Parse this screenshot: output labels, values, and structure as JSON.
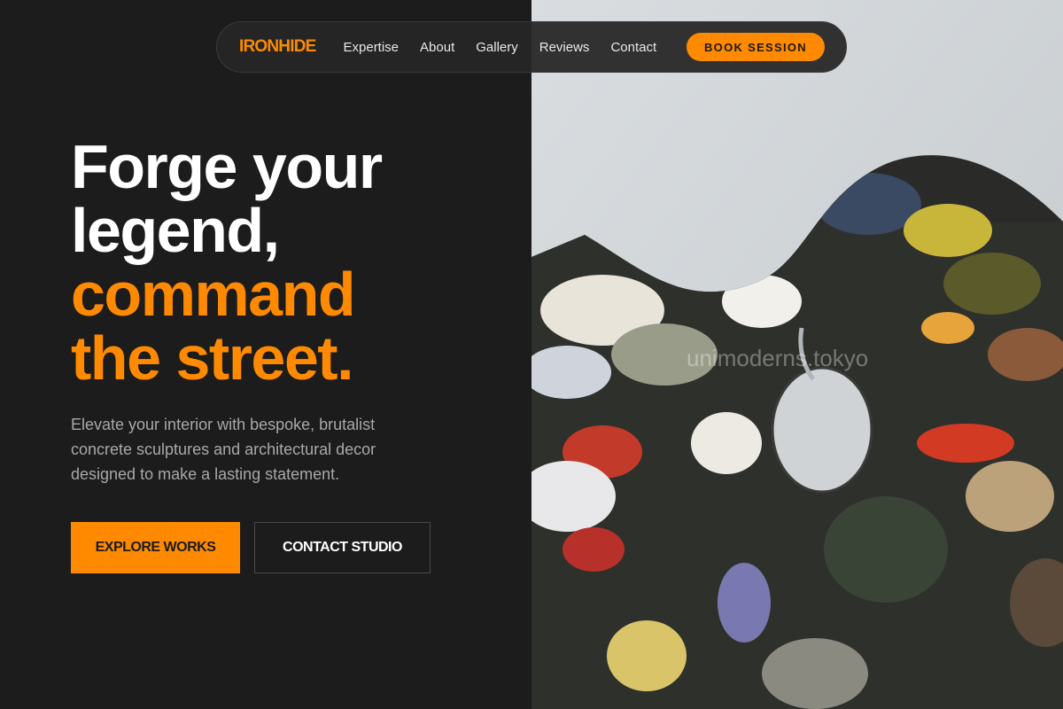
{
  "nav": {
    "logo": "IRONHIDE",
    "links": [
      "Expertise",
      "About",
      "Gallery",
      "Reviews",
      "Contact"
    ],
    "cta": "BOOK SESSION"
  },
  "hero": {
    "line1": "Forge your",
    "line2": "legend,",
    "line3": "command",
    "line4": "the street.",
    "subtitle": "Elevate your interior with bespoke, brutalist concrete sculptures and architectural decor designed to make a lasting statement.",
    "primary_button": "EXPLORE WORKS",
    "secondary_button": "CONTACT STUDIO"
  },
  "image": {
    "description_icon": "paint-palette-image",
    "watermark": "unimoderns.tokyo"
  },
  "colors": {
    "accent": "#ff8a00",
    "background": "#1c1c1c",
    "nav_background": "#262626",
    "text_muted": "#a8a8a8"
  }
}
